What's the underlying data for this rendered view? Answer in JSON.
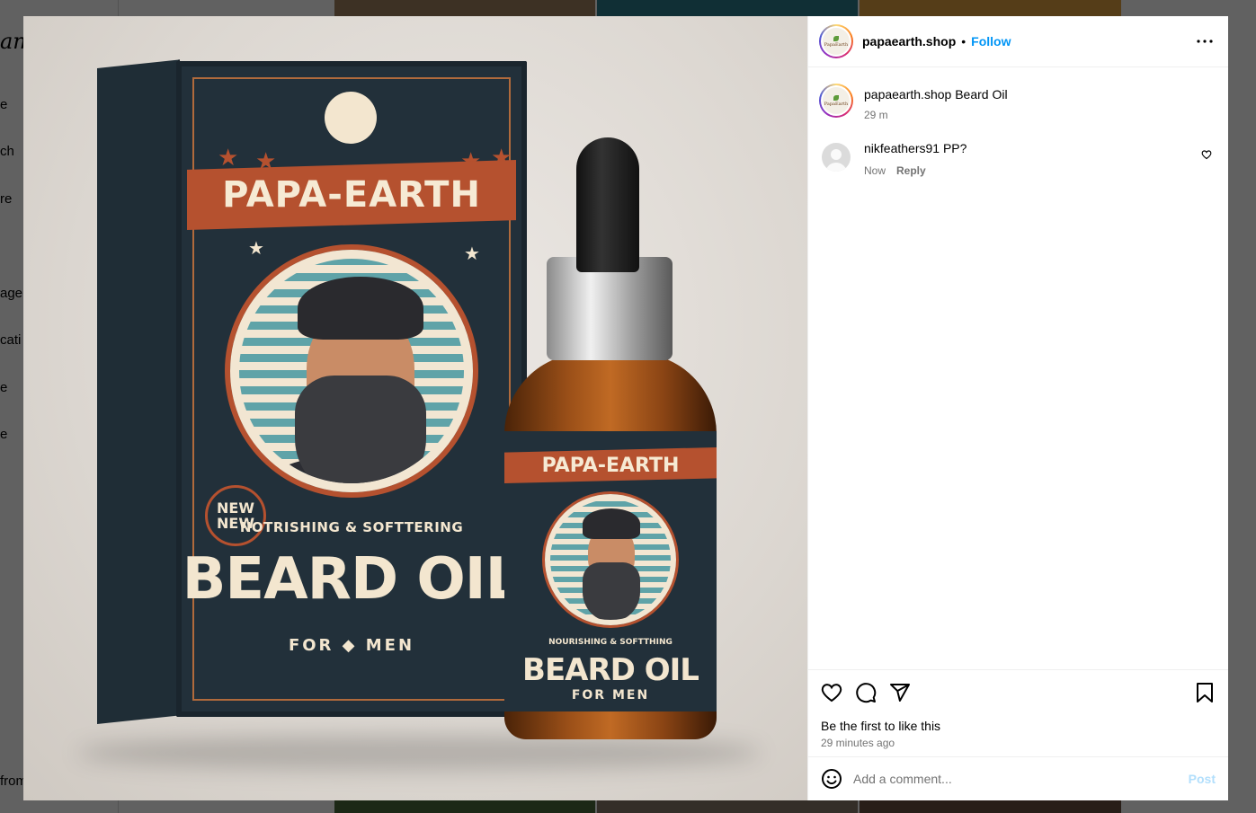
{
  "background": {
    "logo_fragment": "am",
    "nav_fragments": [
      "e",
      "ch",
      "re",
      "age",
      "cati",
      "e",
      "e",
      "from"
    ]
  },
  "post_image": {
    "box": {
      "brand": "PAPA-EARTH",
      "badge": "NEW NEW",
      "subtitle": "NOTRISHING & SOFTTERING",
      "product": "BEARD OIL",
      "for_men": "FOR  ◆  MEN"
    },
    "bottle": {
      "brand": "PAPA-EARTH",
      "subtitle": "NOURISHING & SOFTTHING",
      "product": "BEARD OIL",
      "for_men": "FOR MEN"
    }
  },
  "header": {
    "username": "papaearth.shop",
    "separator": "•",
    "follow_label": "Follow",
    "avatar_text": "PapaEarth"
  },
  "caption": {
    "username": "papaearth.shop",
    "text": "Beard Oil",
    "time": "29 m"
  },
  "comments": [
    {
      "username": "nikfeathers91",
      "text": "PP?",
      "time": "Now",
      "reply_label": "Reply"
    }
  ],
  "actions": {
    "likes_text": "Be the first to like this",
    "time_ago": "29 minutes ago"
  },
  "add_comment": {
    "placeholder": "Add a comment...",
    "post_label": "Post"
  },
  "colors": {
    "accent": "#0095f6",
    "post_disabled": "#b2dffc",
    "meta": "#737373"
  }
}
